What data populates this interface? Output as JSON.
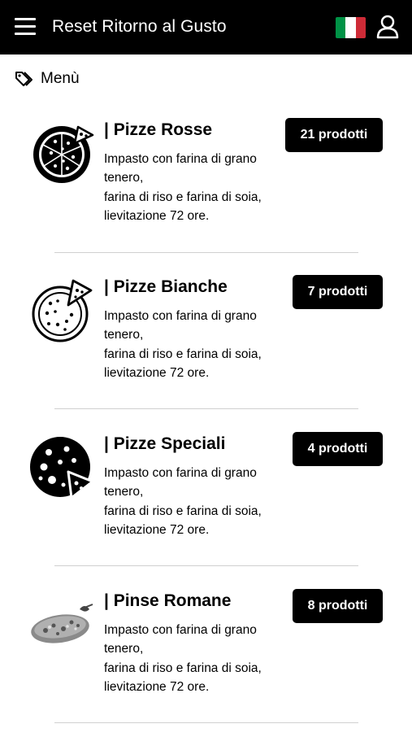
{
  "header": {
    "title": "Reset Ritorno al Gusto",
    "flag_colors": [
      "#009246",
      "#ffffff",
      "#ce2b37"
    ]
  },
  "breadcrumb": {
    "label": "Menù"
  },
  "categories": [
    {
      "title": "| Pizze Rosse",
      "badge": "21 prodotti",
      "desc_1": "Impasto con farina di grano tenero,",
      "desc_2": "farina di riso e farina di soia,",
      "desc_3": "lievitazione 72 ore."
    },
    {
      "title": "| Pizze Bianche",
      "badge": "7 prodotti",
      "desc_1": "Impasto con farina di grano tenero,",
      "desc_2": "farina di riso e farina di soia,",
      "desc_3": "lievitazione 72 ore."
    },
    {
      "title": "| Pizze Speciali",
      "badge": "4 prodotti",
      "desc_1": "Impasto con farina di grano tenero,",
      "desc_2": "farina di riso e farina di soia,",
      "desc_3": "lievitazione 72 ore."
    },
    {
      "title": "| Pinse Romane",
      "badge": "8 prodotti",
      "desc_1": "Impasto con farina di grano tenero,",
      "desc_2": "farina di riso e farina di soia,",
      "desc_3": "lievitazione 72 ore."
    }
  ]
}
